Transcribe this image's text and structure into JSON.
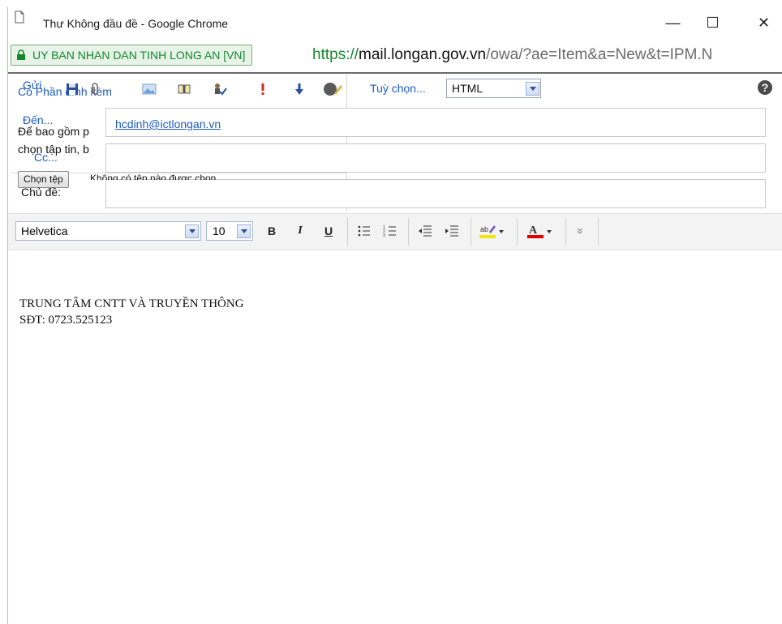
{
  "window": {
    "title": "Thư Không đầu đề - Google Chrome",
    "minimize_glyph": "—",
    "maximize_glyph": "☐",
    "close_glyph": "✕"
  },
  "address_bar": {
    "ev_label": "UY BAN NHAN DAN TINH LONG AN [VN]",
    "url_scheme": "https://",
    "url_host": "mail.longan.gov.vn",
    "url_path": "/owa/?ae=Item&a=New&t=IPM.N"
  },
  "toolbar": {
    "send_label": "Gửi",
    "attach_label": "Có Phần đính kèm",
    "options_label": "Tuỳ chọn...",
    "format_value": "HTML",
    "help_glyph": "?"
  },
  "recipients": {
    "to_label": "Đến...",
    "to_value": "hcdinh@ictlongan.vn",
    "cc_label": "Cc...",
    "subject_label": "Chủ đề:"
  },
  "attachment": {
    "note_line1": "Để bao gồm p",
    "note_line2": "chọn tập tin, b",
    "choose_file_label": "Chọn tệp",
    "no_file_text": "Không có tệp nào được chọn"
  },
  "formatting": {
    "font_value": "Helvetica",
    "size_value": "10",
    "bold": "B",
    "italic": "I",
    "underline": "U",
    "more_glyph": "»"
  },
  "body": {
    "line1": "TRUNG TÂM CNTT VÀ TRUYỀN THÔNG",
    "line2": "SĐT: 0723.525123"
  },
  "colors": {
    "link": "#1c5bc4",
    "ev_green": "#13872b",
    "highlight_bar": "#f5e60a",
    "font_color_bar": "#e00000"
  }
}
